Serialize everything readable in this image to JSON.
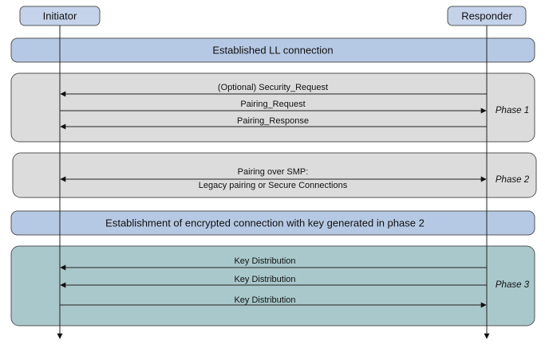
{
  "actors": {
    "initiator": "Initiator",
    "responder": "Responder"
  },
  "bands": {
    "established": "Established LL connection",
    "encrypted": "Establishment of encrypted connection with key generated in phase 2"
  },
  "phases": {
    "phase1": {
      "label": "Phase 1",
      "messages": [
        {
          "text": "(Optional) Security_Request",
          "direction": "to-initiator"
        },
        {
          "text": "Pairing_Request",
          "direction": "to-responder"
        },
        {
          "text": "Pairing_Response",
          "direction": "to-initiator"
        }
      ]
    },
    "phase2": {
      "label": "Phase 2",
      "line1": "Pairing over SMP:",
      "line2": "Legacy pairing or Secure Connections",
      "direction": "both"
    },
    "phase3": {
      "label": "Phase 3",
      "messages": [
        {
          "text": "Key Distribution",
          "direction": "to-initiator"
        },
        {
          "text": "Key Distribution",
          "direction": "to-initiator"
        },
        {
          "text": "Key Distribution",
          "direction": "to-responder"
        }
      ]
    }
  },
  "colors": {
    "actor_fill": "#c5d3ea",
    "band_fill": "#b6c9e4",
    "phase_fill": "#dcdcdc",
    "phase3_fill": "#a9c8cb",
    "stroke": "#555555"
  }
}
